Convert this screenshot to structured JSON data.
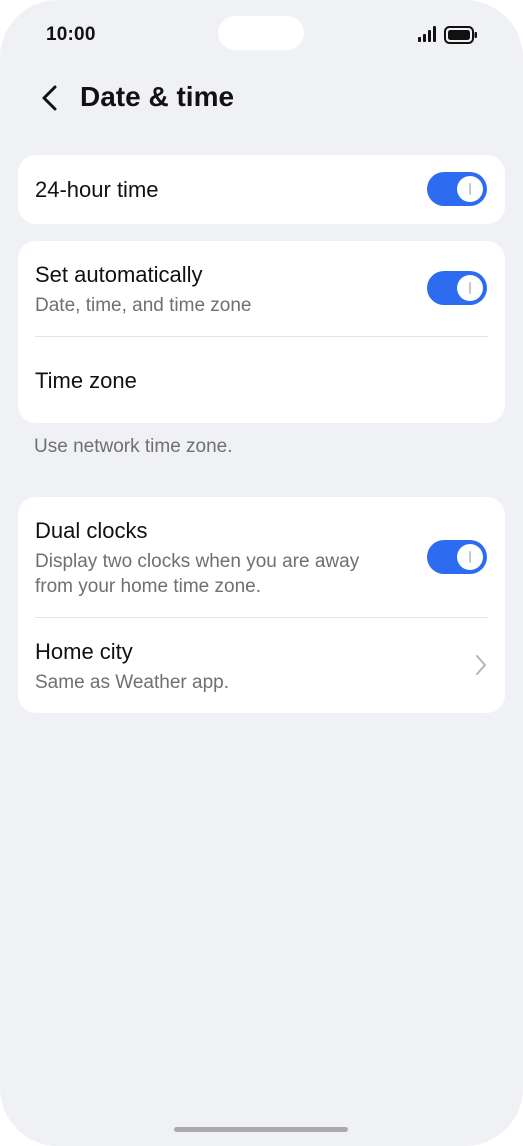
{
  "status_bar": {
    "time": "10:00",
    "signal_icon": "signal-bars-icon",
    "battery_icon": "battery-full-icon"
  },
  "header": {
    "back_icon": "chevron-left-icon",
    "title": "Date & time"
  },
  "settings": {
    "hour24": {
      "title": "24-hour time",
      "toggle_on": true
    },
    "set_automatically": {
      "title": "Set automatically",
      "subtitle": "Date, time, and time zone",
      "toggle_on": true
    },
    "time_zone": {
      "title": "Time zone"
    },
    "time_zone_note": "Use network time zone.",
    "dual_clocks": {
      "title": "Dual clocks",
      "subtitle_line1": "Display two clocks when you are away",
      "subtitle_line2": "from your home time zone.",
      "toggle_on": true
    },
    "home_city": {
      "title": "Home city",
      "subtitle": "Same as Weather app.",
      "chevron_icon": "chevron-right-icon"
    }
  },
  "colors": {
    "background": "#f0f1f5",
    "card": "#ffffff",
    "accent": "#2d6bf0",
    "secondary_text": "#6f6f74"
  }
}
